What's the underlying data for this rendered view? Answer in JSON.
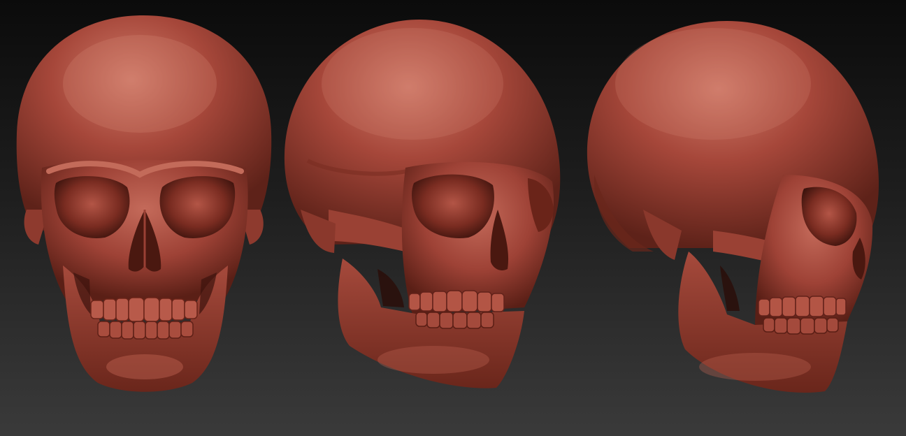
{
  "scene": {
    "background_top": "#0b0b0b",
    "background_bottom": "#3a3a3a",
    "material_base": "#a6473a",
    "material_shadow": "#5e2219",
    "material_highlight": "#cf7a69",
    "cavity": "#3c130d",
    "views": [
      {
        "name": "front-view"
      },
      {
        "name": "three-quarter-view"
      },
      {
        "name": "side-view"
      }
    ]
  }
}
